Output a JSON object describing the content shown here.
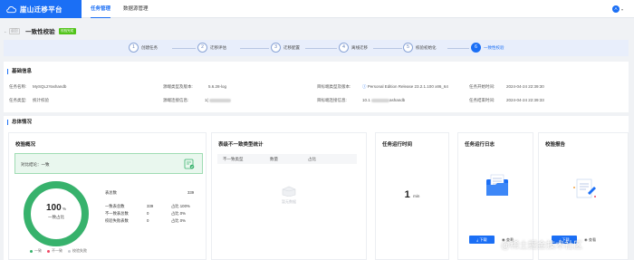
{
  "app": {
    "title": "崖山迁移平台"
  },
  "nav": {
    "items": [
      "任务管理",
      "数据源管理"
    ]
  },
  "user": {
    "avatar_letter": "A"
  },
  "header": {
    "back_label": "返回",
    "title": "一致性校验",
    "status_badge": "校验完成"
  },
  "steps": [
    {
      "num": "1",
      "label": "创建任务"
    },
    {
      "num": "2",
      "label": "迁移评估"
    },
    {
      "num": "3",
      "label": "迁移配置"
    },
    {
      "num": "4",
      "label": "离线迁移"
    },
    {
      "num": "5",
      "label": "校验初始化"
    },
    {
      "num": "6",
      "label": "一致性校验"
    }
  ],
  "basic_info": {
    "section_title": "基础信息",
    "task_name_label": "任务名称:",
    "task_name_value": "MySQL2Yashandb",
    "task_type_label": "任务类型:",
    "task_type_value": "统计校验",
    "src_version_label": "源端类型及版本:",
    "src_version_value": "5.6.28-log",
    "src_addr_label": "源端连接信息:",
    "src_addr_value": "1(",
    "tgt_version_label": "目标端类型及版本:",
    "tgt_version_value": "Personal Edition Release 23.2.1.100 x86_64",
    "tgt_addr_label": "目标端连接信息:",
    "tgt_addr_value": "10.1",
    "tgt_addr_suffix": "ashandb",
    "start_time_label": "任务开始时间:",
    "start_time_value": "2024-04-24 22:39:30",
    "end_time_label": "任务结束时间:",
    "end_time_value": "2024-04-24 22:39:33"
  },
  "overview": {
    "section_title": "总体情况",
    "check_overview": {
      "title": "校验概况",
      "result_text": "对比结论：一致",
      "percent": "100",
      "percent_unit": "%",
      "ring_sub_label": "一致占比",
      "consistent_fraction": 1.0,
      "stats": [
        {
          "label": "表总数",
          "value": "339",
          "pct": ""
        },
        {
          "label": "一致表总数",
          "value": "339",
          "pct": "占比 100%"
        },
        {
          "label": "不一致表总数",
          "value": "0",
          "pct": "占比 0%"
        },
        {
          "label": "校验失败表数",
          "value": "0",
          "pct": "占比 0%"
        }
      ],
      "legend": [
        "一致",
        "不一致",
        "校验失败"
      ],
      "colors": {
        "consistent": "#37b26c",
        "inconsistent": "#f04864",
        "failed": "#c9ccd1"
      }
    },
    "inconsistent_stats": {
      "title": "表级不一致类型统计",
      "columns": [
        "不一致类型",
        "数量",
        "占比"
      ],
      "empty_text": "暂无数据"
    },
    "run_time": {
      "title": "任务运行时间",
      "value": "1",
      "unit": "min"
    },
    "run_log": {
      "title": "任务运行日志",
      "download": "下载",
      "view": "查看"
    },
    "report": {
      "title": "校验报告",
      "download": "下载",
      "view": "查看"
    }
  },
  "watermark": "@稀土掘金技术社区"
}
